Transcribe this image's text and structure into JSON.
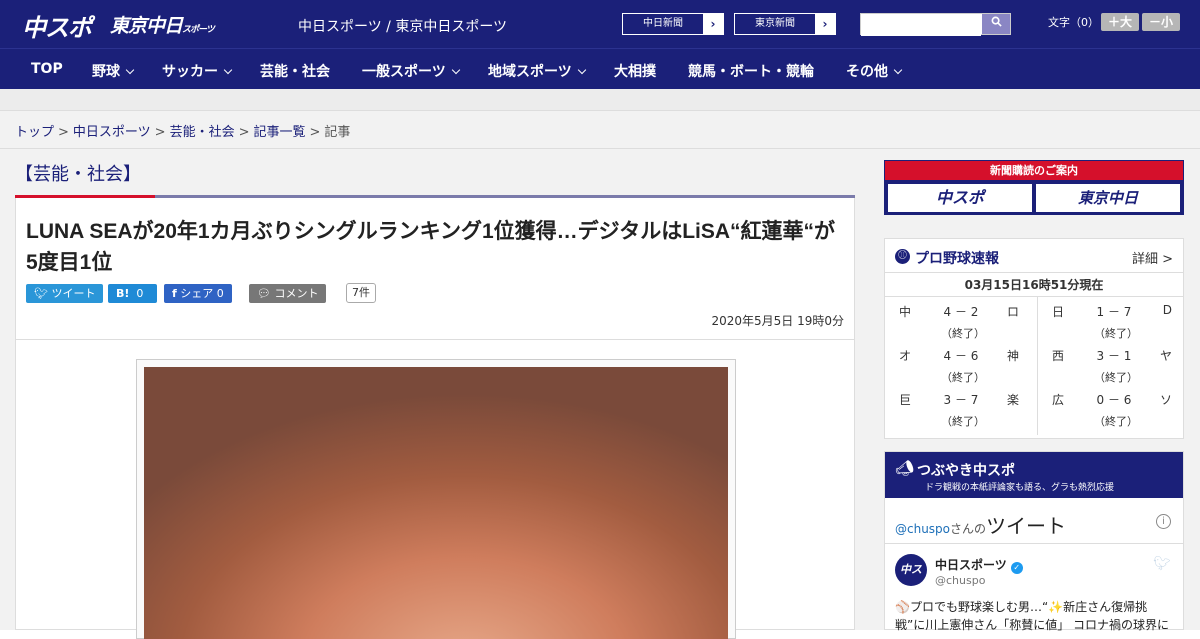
{
  "header": {
    "logo_chuspo": "中スポ",
    "logo_tokyo": "東京中日",
    "logo_tokyo_sub": "スポーツ",
    "site_names": "中日スポーツ / 東京中日スポーツ",
    "paper_buttons": [
      "中日新聞",
      "東京新聞"
    ],
    "search_placeholder": "",
    "font_size_label": "文字（0）",
    "font_plus": "＋大",
    "font_minus": "－小"
  },
  "nav": {
    "items": [
      {
        "label": "TOP",
        "has_menu": false
      },
      {
        "label": "野球",
        "has_menu": true
      },
      {
        "label": "サッカー",
        "has_menu": true
      },
      {
        "label": "芸能・社会",
        "has_menu": false
      },
      {
        "label": "一般スポーツ",
        "has_menu": true
      },
      {
        "label": "地域スポーツ",
        "has_menu": true
      },
      {
        "label": "大相撲",
        "has_menu": false
      },
      {
        "label": "競馬・ボート・競輪",
        "has_menu": false
      },
      {
        "label": "その他",
        "has_menu": true
      }
    ]
  },
  "breadcrumb": [
    "トップ",
    "中日スポーツ",
    "芸能・社会",
    "記事一覧",
    "記事"
  ],
  "article": {
    "category": "【芸能・社会】",
    "title": "LUNA SEAが20年1カ月ぶりシングルランキング1位獲得…デジタルはLiSA“紅蓮華“が5度目1位",
    "share": {
      "tweet": "ツイート",
      "hatena": "0",
      "facebook": "シェア 0",
      "comment": "コメント",
      "comment_count": "7件"
    },
    "date": "2020年5月5日 19時0分"
  },
  "sidebar": {
    "subscribe": {
      "header": "新聞購読のご案内",
      "buttons": [
        "中スポ",
        "東京中日"
      ]
    },
    "baseball": {
      "title": "プロ野球速報",
      "more": "詳細 >",
      "as_of": "03月15日16時51分現在",
      "games_left": [
        {
          "home": "中",
          "score": "4 － 2",
          "away": "ロ",
          "status": "（終了）"
        },
        {
          "home": "オ",
          "score": "4 － 6",
          "away": "神",
          "status": "（終了）"
        },
        {
          "home": "巨",
          "score": "3 － 7",
          "away": "楽",
          "status": "（終了）"
        }
      ],
      "games_right": [
        {
          "home": "日",
          "score": "1 － 7",
          "away": "D",
          "status": "（終了）"
        },
        {
          "home": "西",
          "score": "3 － 1",
          "away": "ヤ",
          "status": "（終了）"
        },
        {
          "home": "広",
          "score": "0 － 6",
          "away": "ソ",
          "status": "（終了）"
        }
      ]
    },
    "tweets": {
      "title": "つぶやき中スポ",
      "subtitle": "ドラ観戦の本紙評論家も語る、グラも熱烈応援",
      "handle_prefix": "@chuspo",
      "handle_suffix": "さんの",
      "heading": "ツイート",
      "author": "中日スポーツ",
      "author_handle": "@chuspo",
      "text": "⚾プロでも野球楽しむ男…“✨新庄さん復帰挑戦”に川上憲伸さん「称賛に値」 コロナ禍の球界に"
    }
  }
}
